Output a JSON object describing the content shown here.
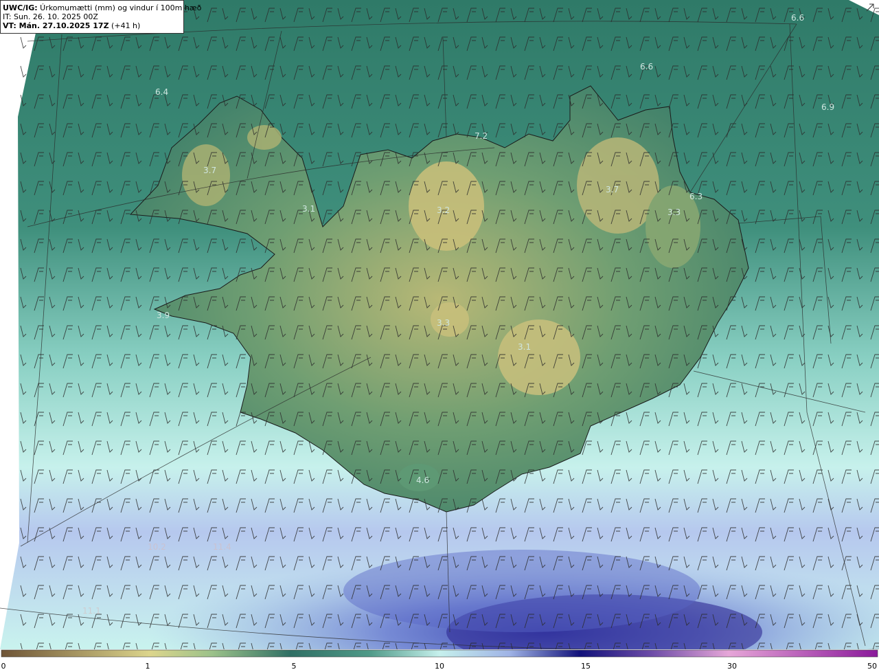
{
  "header": {
    "model": "UWC/IG:",
    "title": " Úrkomumætti (mm) og vindur í 100m hæð",
    "init_time": "IT: Sun. 26. 10. 2025 00Z",
    "valid_label": "VT: Mán. 27.10.2025 17Z",
    "valid_offset": " (+41 h)"
  },
  "value_labels": [
    {
      "text": "6.6"
    },
    {
      "text": "6.6"
    },
    {
      "text": "6.9"
    },
    {
      "text": "6.4"
    },
    {
      "text": "7.2"
    },
    {
      "text": "3.7"
    },
    {
      "text": "3.7"
    },
    {
      "text": "3.3"
    },
    {
      "text": "6.3"
    },
    {
      "text": "3.1"
    },
    {
      "text": "3.2"
    },
    {
      "text": "3.9"
    },
    {
      "text": "3.3"
    },
    {
      "text": "3.1"
    },
    {
      "text": "4.6"
    },
    {
      "text": "10.2"
    },
    {
      "text": "11.4"
    },
    {
      "text": "11.1"
    }
  ],
  "colorbar": {
    "ticks": [
      "0",
      "1",
      "5",
      "10",
      "15",
      "30",
      "50"
    ],
    "colors": [
      "#7a5a3a",
      "#b5a25a",
      "#dcd58c",
      "#9cc28a",
      "#3f8a6e",
      "#2f6f64",
      "#7fbfae",
      "#c6f0ec",
      "#8fa3de",
      "#3a3aa6",
      "#12127a",
      "#b07ac8",
      "#e6a6d8",
      "#a23aa6",
      "#7a1a8a"
    ]
  },
  "icons": {
    "corner": "expand-icon"
  }
}
